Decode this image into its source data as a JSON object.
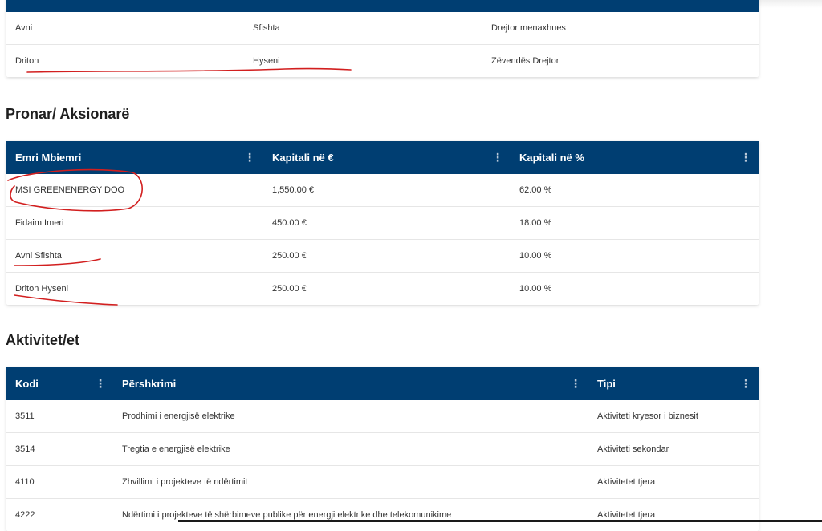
{
  "managers": {
    "rows": [
      [
        "Avni",
        "Sfishta",
        "Drejtor menaxhues"
      ],
      [
        "Driton",
        "Hyseni",
        "Zëvendës Drejtor"
      ]
    ]
  },
  "owners": {
    "title": "Pronar/ Aksionarë",
    "headers": [
      "Emri Mbiemri",
      "Kapitali në €",
      "Kapitali në %"
    ],
    "rows": [
      [
        "MSI GREENENERGY DOO",
        "1,550.00 €",
        "62.00 %"
      ],
      [
        "Fidaim Imeri",
        "450.00 €",
        "18.00 %"
      ],
      [
        "Avni Sfishta",
        "250.00 €",
        "10.00 %"
      ],
      [
        "Driton Hyseni",
        "250.00 €",
        "10.00 %"
      ]
    ]
  },
  "activities": {
    "title": "Aktivitet/et",
    "headers": [
      "Kodi",
      "Përshkrimi",
      "Tipi"
    ],
    "rows": [
      [
        "3511",
        "Prodhimi i energjisë elektrike",
        "Aktiviteti kryesor i biznesit"
      ],
      [
        "3514",
        "Tregtia e energjisë elektrike",
        "Aktiviteti sekondar"
      ],
      [
        "4110",
        "Zhvillimi i projekteve të ndërtimit",
        "Aktivitetet tjera"
      ],
      [
        "4222",
        "Ndërtimi i projekteve të shërbimeve publike për energji elektrike dhe telekomunikime",
        "Aktivitetet tjera"
      ]
    ]
  },
  "column_menu_icon": "vertical-dots-icon",
  "colors": {
    "header_bg": "#003e72",
    "annotation": "#d21f1f"
  }
}
